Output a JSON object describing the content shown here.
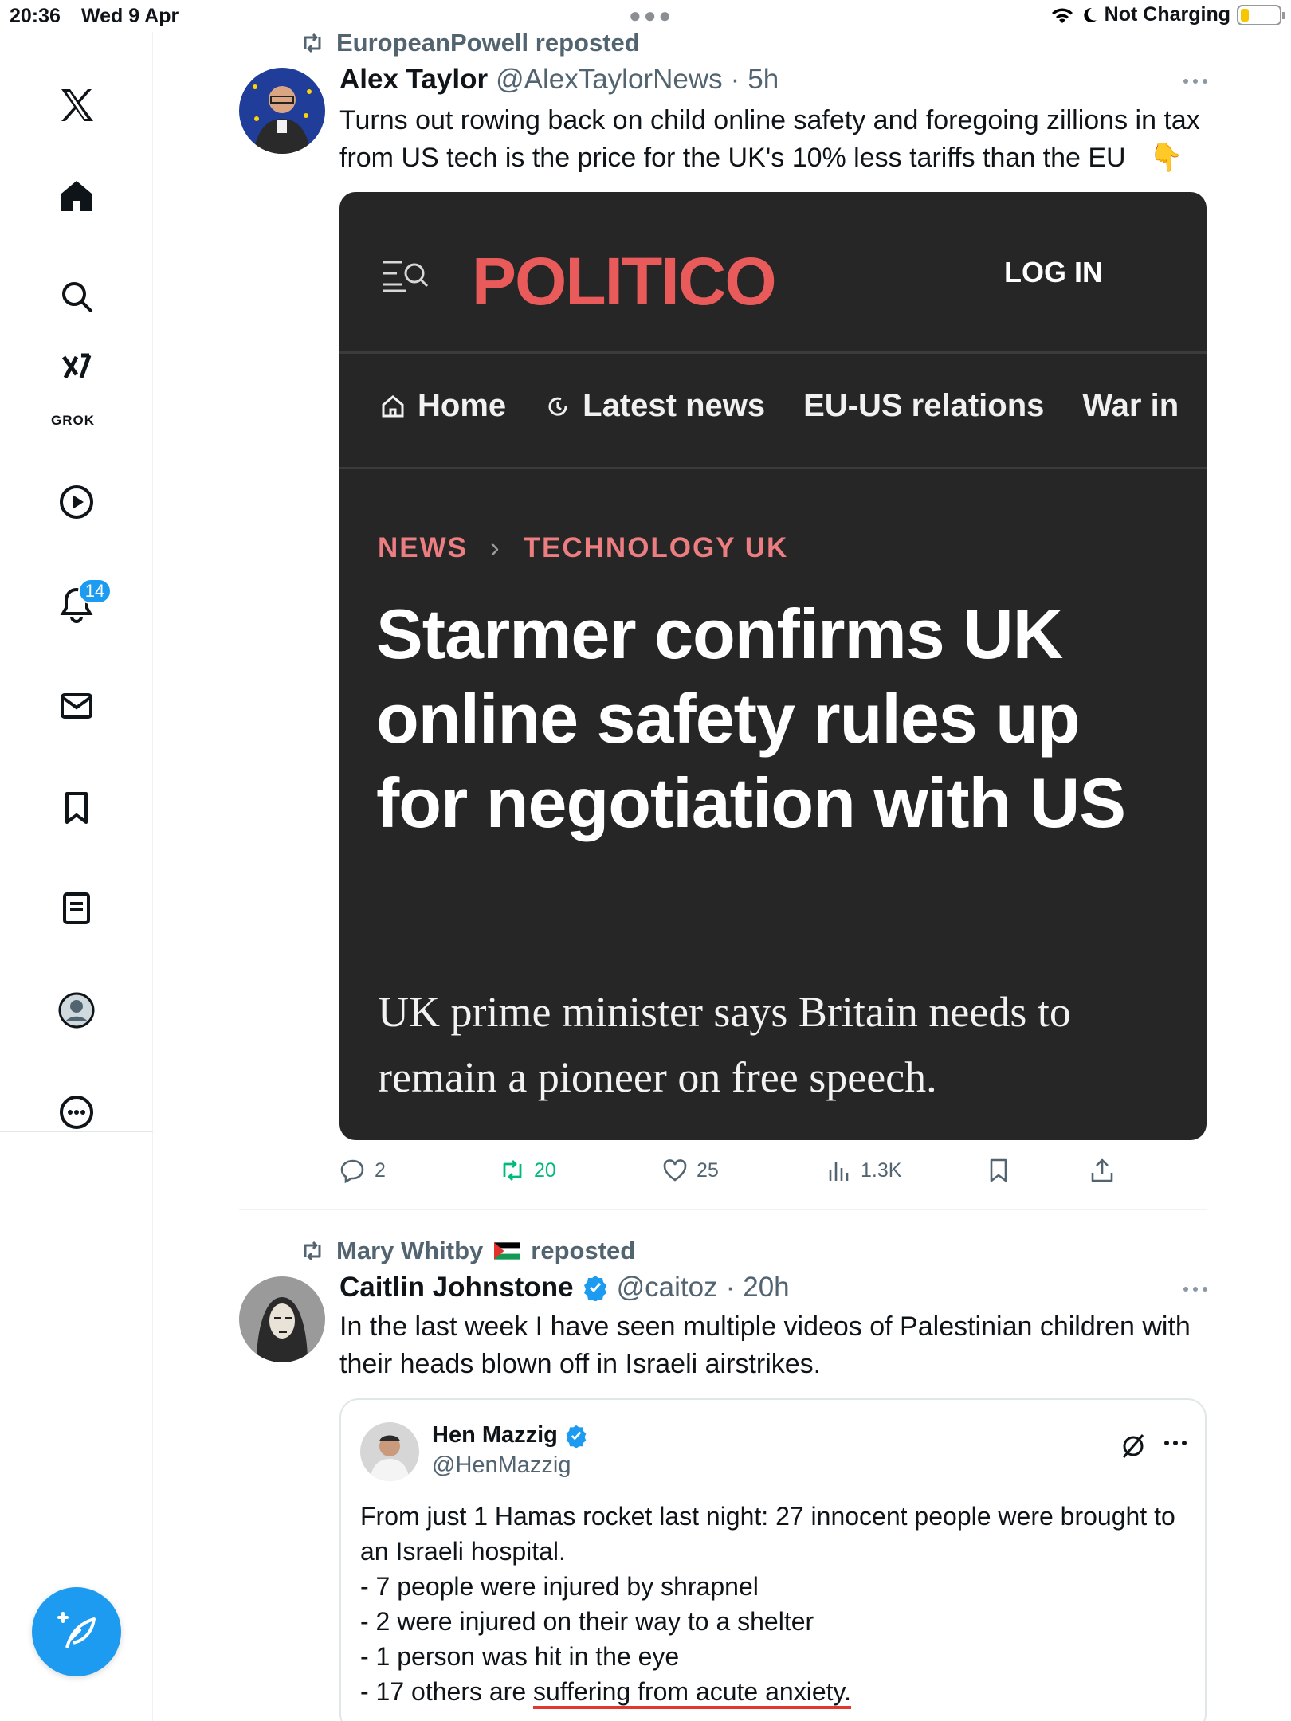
{
  "status_bar": {
    "time": "20:36",
    "date": "Wed 9 Apr",
    "charging": "Not Charging"
  },
  "sidebar": {
    "items": [
      {
        "name": "home"
      },
      {
        "name": "explore"
      },
      {
        "name": "grok",
        "label": "GROK"
      },
      {
        "name": "videos"
      },
      {
        "name": "notifications",
        "badge": "14"
      },
      {
        "name": "messages"
      },
      {
        "name": "bookmarks"
      },
      {
        "name": "lists"
      },
      {
        "name": "profile"
      },
      {
        "name": "more"
      }
    ]
  },
  "tweets": [
    {
      "reposted_by": "EuropeanPowell reposted",
      "author_name": "Alex Taylor",
      "author_handle": "@AlexTaylorNews",
      "time": "5h",
      "text_line1": "Turns out rowing back on child online safety and foregoing zillions in tax",
      "text_line2": "from US tech is the price for the UK's 10% less tariffs than the EU",
      "emoji": "👇",
      "card": {
        "logo": "POLITICO",
        "login": "LOG IN",
        "nav": [
          "Home",
          "Latest news",
          "EU-US relations",
          "War in"
        ],
        "crumb_section": "NEWS",
        "crumb_topic": "TECHNOLOGY UK",
        "headline": "Starmer confirms UK online safety rules up for negotiation with US",
        "subhead": "UK prime minister says Britain needs to remain a pioneer on free speech."
      },
      "stats": {
        "replies": "2",
        "reposts": "20",
        "likes": "25",
        "views": "1.3K"
      }
    },
    {
      "reposted_by_name": "Mary Whitby",
      "reposted_suffix": "reposted",
      "author_name": "Caitlin Johnstone",
      "author_handle": "@caitoz",
      "time": "20h",
      "text_line1": "In the last week I have seen multiple videos of Palestinian children with",
      "text_line2": "their heads blown off in Israeli airstrikes.",
      "quote": {
        "author_name": "Hen Mazzig",
        "author_handle": "@HenMazzig",
        "lines": [
          "From just 1 Hamas rocket last night: 27 innocent people were brought to",
          "an Israeli hospital.",
          "- 7 people were injured by shrapnel",
          "- 2 were injured on their way to a shelter",
          "- 1 person was hit in the eye"
        ],
        "last_line_prefix": "- 17 others are ",
        "last_line_underlined": "suffering from acute anxiety."
      }
    }
  ],
  "colors": {
    "accent": "#1d9bf0",
    "repost_green": "#00ba7c",
    "politico_red": "#e95a5a",
    "card_bg": "#262626"
  }
}
